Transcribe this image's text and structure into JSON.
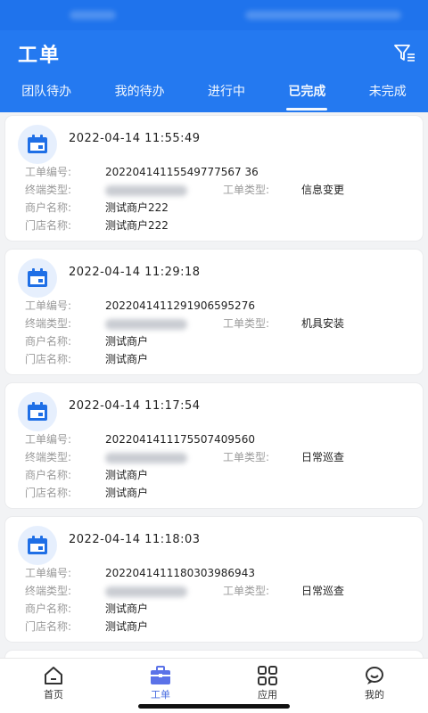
{
  "header": {
    "title": "工单"
  },
  "tabs": [
    {
      "label": "团队待办",
      "active": false
    },
    {
      "label": "我的待办",
      "active": false
    },
    {
      "label": "进行中",
      "active": false
    },
    {
      "label": "已完成",
      "active": true
    },
    {
      "label": "未完成",
      "active": false
    }
  ],
  "labels": {
    "order_no": "工单编号:",
    "terminal_type": "终端类型:",
    "order_type": "工单类型:",
    "merchant": "商户名称:",
    "store": "门店名称:"
  },
  "cards": [
    {
      "time": "2022-04-14 11:55:49",
      "order_no": "20220414115549777567 36",
      "order_type": "信息变更",
      "merchant": "测试商户222",
      "store": "测试商户222"
    },
    {
      "time": "2022-04-14 11:29:18",
      "order_no": "2022041411291906595276",
      "order_type": "机具安装",
      "merchant": "测试商户",
      "store": "测试商户"
    },
    {
      "time": "2022-04-14 11:17:54",
      "order_no": "2022041411175507409560",
      "order_type": "日常巡查",
      "merchant": "测试商户",
      "store": "测试商户"
    },
    {
      "time": "2022-04-14 11:18:03",
      "order_no": "2022041411180303986943",
      "order_type": "日常巡查",
      "merchant": "测试商户",
      "store": "测试商户"
    }
  ],
  "bottom_nav": [
    {
      "label": "首页",
      "icon": "home-icon",
      "active": false
    },
    {
      "label": "工单",
      "icon": "briefcase-icon",
      "active": true
    },
    {
      "label": "应用",
      "icon": "grid-icon",
      "active": false
    },
    {
      "label": "我的",
      "icon": "user-chat-icon",
      "active": false
    }
  ],
  "colors": {
    "primary": "#2479f0",
    "nav_active": "#4a6ee0",
    "icon_bg": "#e6effd"
  }
}
